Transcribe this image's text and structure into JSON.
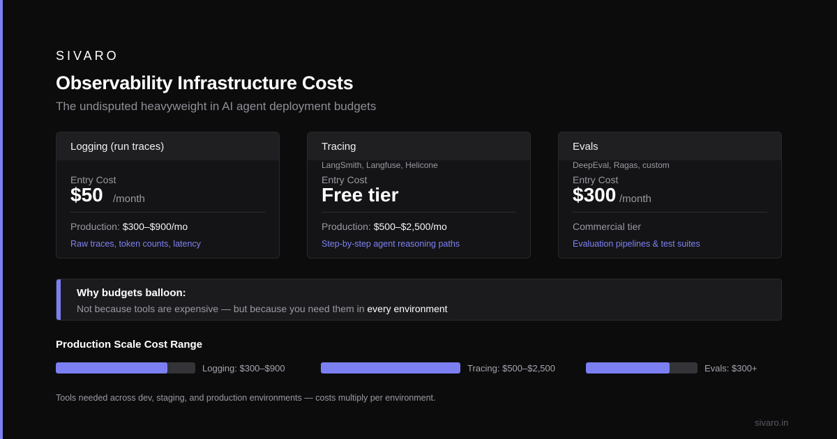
{
  "brand": "SIVARO",
  "title": "Observability Infrastructure Costs",
  "subtitle": "The undisputed heavyweight in AI agent deployment budgets",
  "colors": {
    "accent": "#7c7ff2",
    "background": "#0c0c0d",
    "card": "#141416"
  },
  "cards": [
    {
      "header": "Logging (run traces)",
      "tools": "",
      "entry_label": "Entry Cost",
      "price": "$50",
      "unit": "/month",
      "production_label": "Production: ",
      "production_value": "$300–$900/mo",
      "note": "Raw traces, token counts, latency"
    },
    {
      "header": "Tracing",
      "tools": "LangSmith, Langfuse, Helicone",
      "entry_label": "Entry Cost",
      "price": "Free tier",
      "unit": "",
      "production_label": "Production: ",
      "production_value": "$500–$2,500/mo",
      "note": "Step-by-step agent reasoning paths"
    },
    {
      "header": "Evals",
      "tools": "DeepEval, Ragas, custom",
      "entry_label": "Entry Cost",
      "price": "$300",
      "unit": "/month",
      "production_label": "Commercial tier",
      "production_value": "",
      "note": "Evaluation pipelines & test suites"
    }
  ],
  "callout": {
    "title": "Why budgets balloon:",
    "text": "Not because tools are expensive — but because you need them in ",
    "highlight": "every environment"
  },
  "range": {
    "title": "Production Scale Cost Range",
    "items": [
      {
        "label": "Logging: $300–$900",
        "fill": 0.8
      },
      {
        "label": "Tracing: $500–$2,500",
        "fill": 1.0
      },
      {
        "label": "Evals: $300+",
        "fill": 0.75
      }
    ]
  },
  "footnote": "Tools needed across dev, staging, and production environments — costs multiply per environment.",
  "site": "sivaro.in"
}
